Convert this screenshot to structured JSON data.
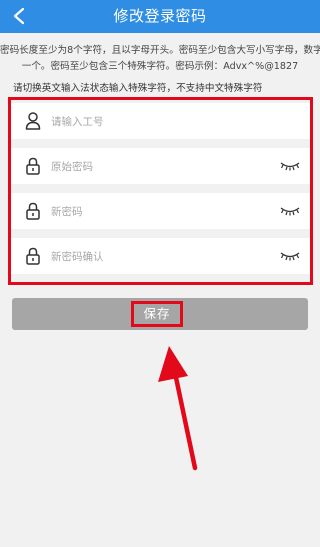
{
  "header": {
    "title": "修改登录密码",
    "back_icon": "chevron-left-icon",
    "color": "#2f8de4"
  },
  "rules": {
    "line1": "密码长度至少为8个字符，且以字母开头。密码至少包含大写小写字母，数字各",
    "line2": "一个。密码至少包含三个特殊字符。密码示例：Advx^%@1827"
  },
  "tip": "请切换英文输入法状态输入特殊字符，不支持中文特殊字符",
  "fields": [
    {
      "placeholder": "请输入工号",
      "icon": "user-icon"
    },
    {
      "placeholder": "原始密码",
      "icon": "lock-icon",
      "toggle_icon": "eye-closed-icon"
    },
    {
      "placeholder": "新密码",
      "icon": "lock-icon",
      "toggle_icon": "eye-closed-icon"
    },
    {
      "placeholder": "新密码确认",
      "icon": "lock-icon",
      "toggle_icon": "eye-closed-icon"
    }
  ],
  "save_button": {
    "label": "保存"
  },
  "annotation_color": "#e2091a"
}
